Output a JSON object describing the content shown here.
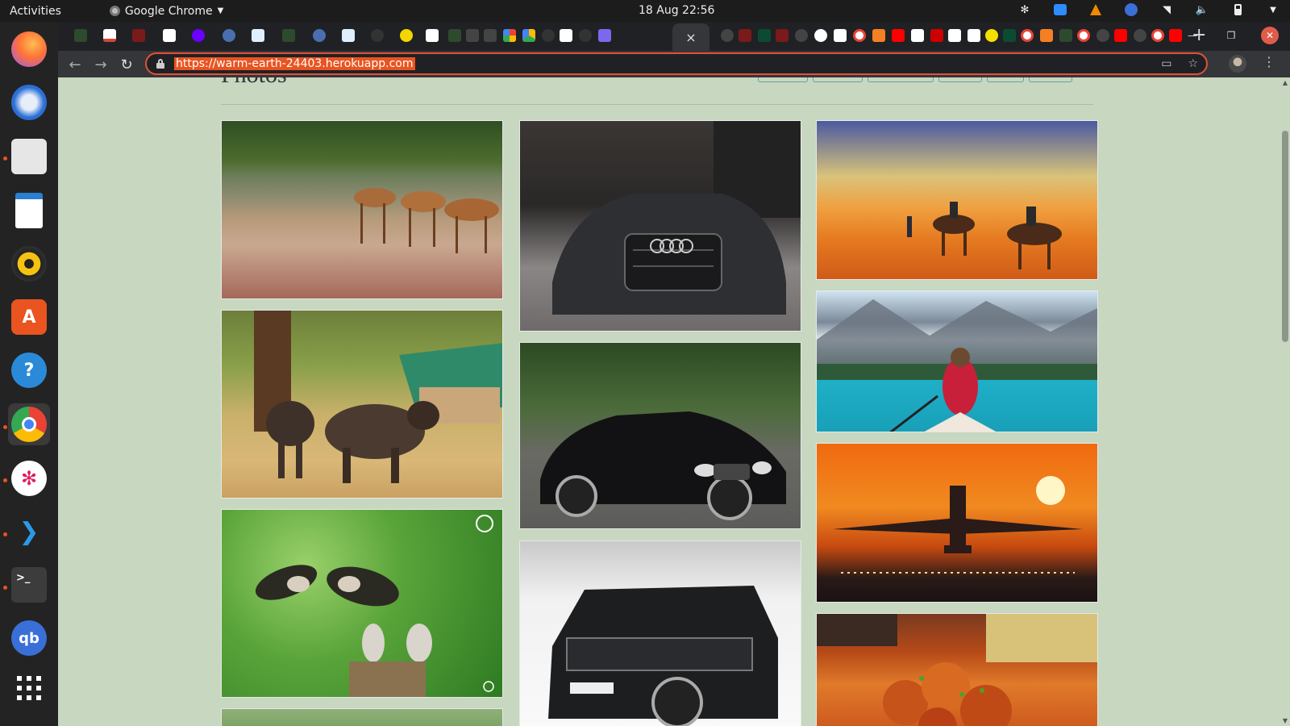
{
  "topbar": {
    "activities": "Activities",
    "app_name": "Google Chrome",
    "clock": "18 Aug  22:56"
  },
  "browser": {
    "url": "https://warm-earth-24403.herokuapp.com",
    "active_tab_close": "×"
  },
  "dock": {
    "items": [
      "firefox-icon",
      "thunderbird-icon",
      "files-icon",
      "writer-icon",
      "rhythmbox-icon",
      "software-icon",
      "help-icon",
      "chrome-icon",
      "slack-icon",
      "vscode-icon",
      "terminal-icon",
      "qbittorrent-icon",
      "app-grid-icon"
    ]
  },
  "page": {
    "heading": "Photos",
    "photos": [
      {
        "subject": "impalas-drinking"
      },
      {
        "subject": "black-audi-sedan"
      },
      {
        "subject": "camels-in-desert"
      },
      {
        "subject": "buffaloes-by-safari-tent"
      },
      {
        "subject": "mercedes-sedan"
      },
      {
        "subject": "kayak-on-mountain-lake"
      },
      {
        "subject": "starlings-on-stump"
      },
      {
        "subject": "land-rover-discovery"
      },
      {
        "subject": "airplane-at-sunset"
      },
      {
        "subject": "orange-chicken-dish"
      }
    ]
  }
}
